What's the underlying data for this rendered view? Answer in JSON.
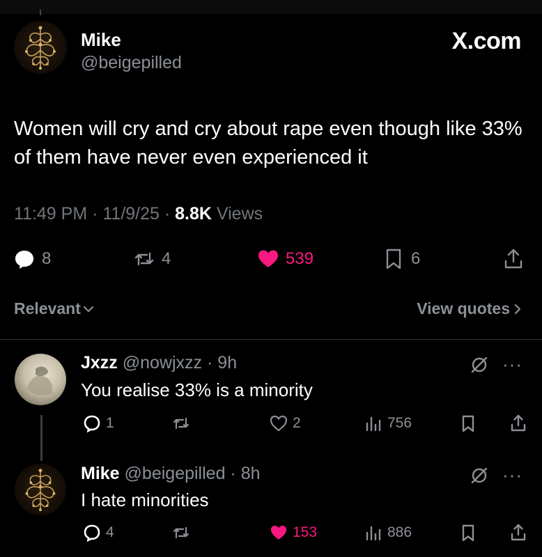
{
  "brand": "X.com",
  "post": {
    "author_name": "Mike",
    "author_handle": "@beigepilled",
    "text": "Women will cry and cry about rape even though like 33% of them have never even experienced it",
    "time": "11:49 PM · 11/9/25 · ",
    "views_count": "8.8K",
    "views_label": " Views",
    "replies": "8",
    "reposts": "4",
    "likes": "539",
    "bookmarks": "6"
  },
  "sort": {
    "label": "Relevant",
    "view_quotes": "View quotes"
  },
  "replies": [
    {
      "name": "Jxzz",
      "handle": "@nowjxzz",
      "time": "· 9h",
      "text": "You realise  33% is a minority",
      "replies": "1",
      "likes": "2",
      "views": "756"
    },
    {
      "name": "Mike",
      "handle": "@beigepilled",
      "time": "· 8h",
      "text": "I hate minorities",
      "replies": "4",
      "likes": "153",
      "views": "886"
    }
  ],
  "colors": {
    "background": "#000000",
    "text": "#e7e9ea",
    "muted": "#8b9096",
    "like_pink": "#f91880"
  },
  "icons": [
    "reply-icon",
    "repost-icon",
    "heart-icon",
    "bookmark-icon",
    "share-icon",
    "views-icon",
    "grok-icon",
    "more-icon",
    "chevron-down-icon",
    "chevron-right-icon"
  ]
}
